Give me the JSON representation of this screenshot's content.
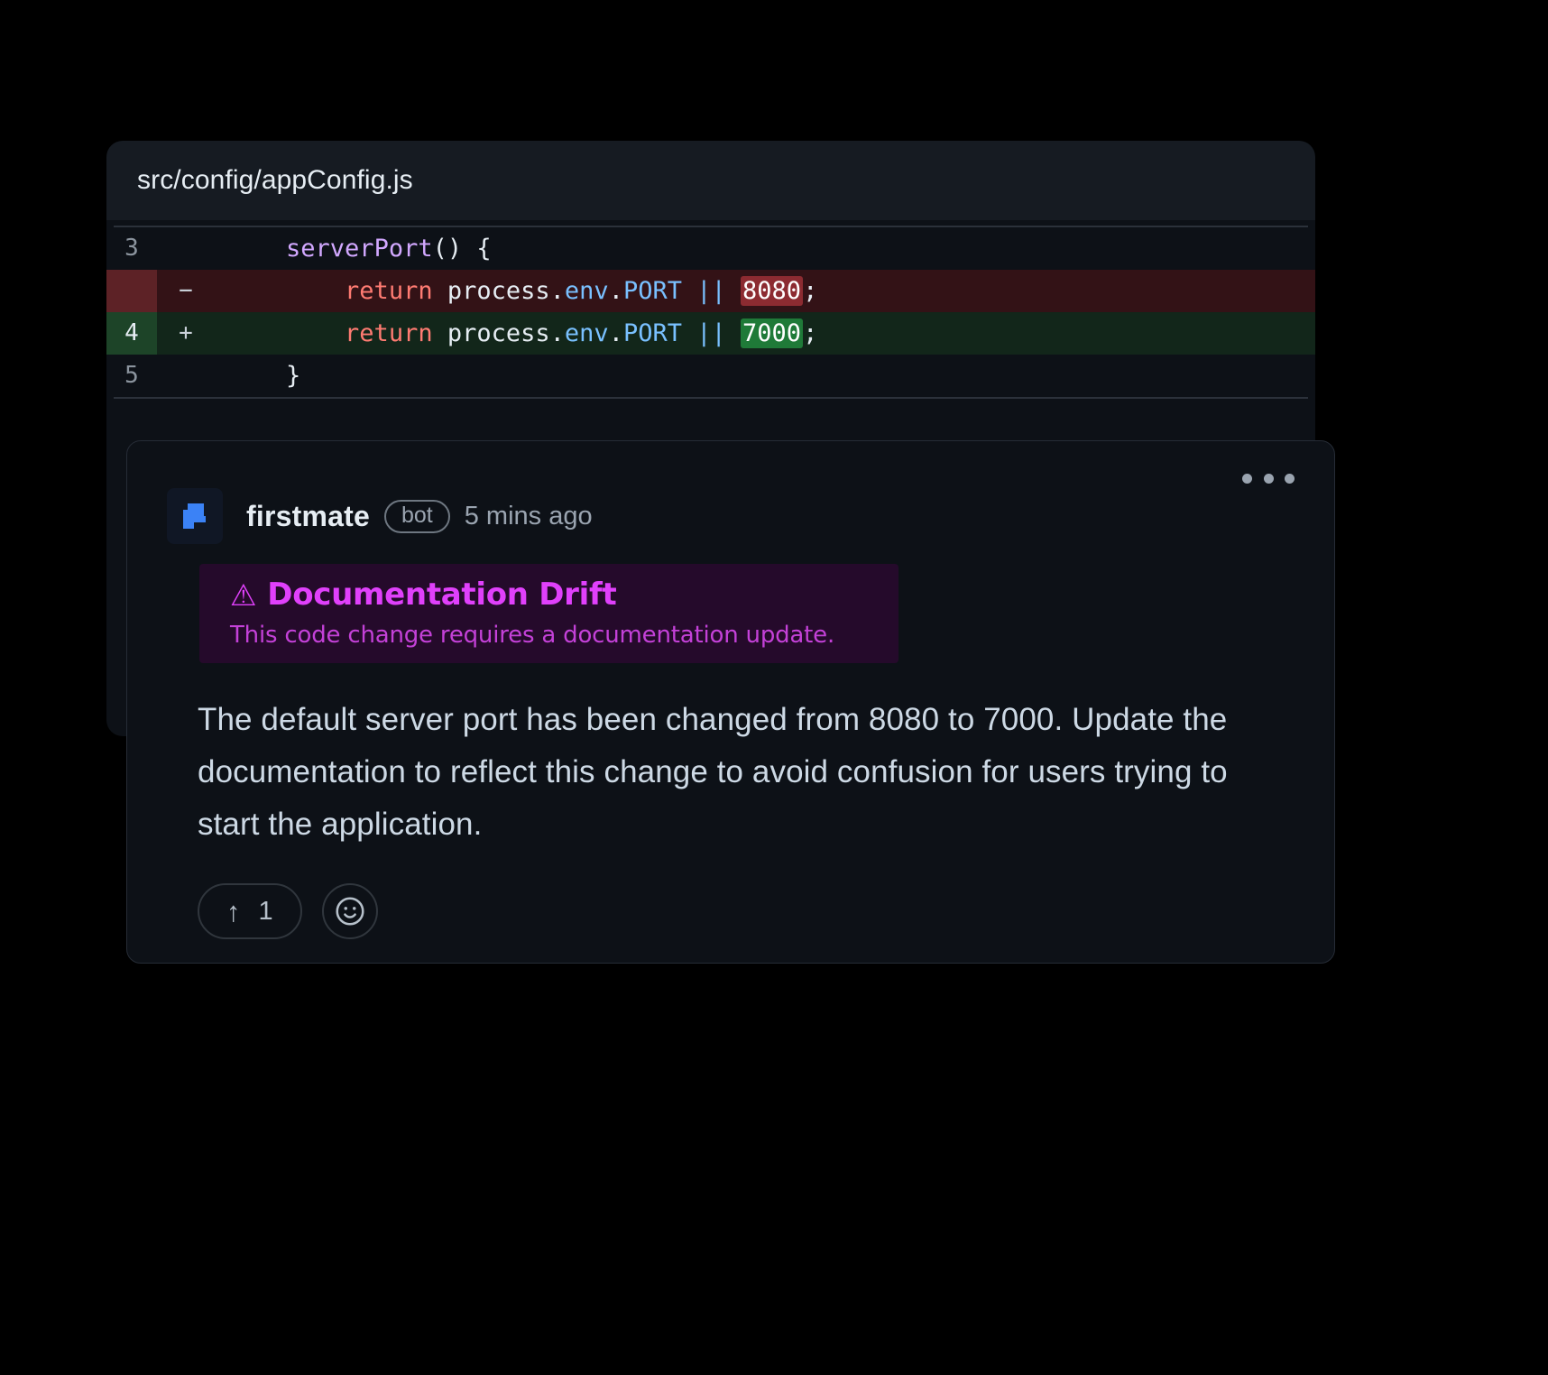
{
  "colors": {
    "page_background": "#000000",
    "card_background": "#0d1117",
    "header_background": "#161b22",
    "deletion_line": "#331216",
    "deletion_gutter": "#5d2226",
    "deletion_highlight": "#8c2b31",
    "addition_line": "#12261a",
    "addition_gutter": "#1d4428",
    "addition_highlight": "#1f7a38",
    "accent_purple": "#e040fb",
    "badge_background": "#250a2b",
    "avatar_blue": "#3b82f6"
  },
  "diff": {
    "filename": "src/config/appConfig.js",
    "lines": [
      {
        "number": "3",
        "marker": "",
        "type": "context",
        "tokens": [
          {
            "text": "    ",
            "kind": "plain"
          },
          {
            "text": "serverPort",
            "kind": "fn"
          },
          {
            "text": "() {",
            "kind": "punc"
          }
        ]
      },
      {
        "number": "",
        "marker": "−",
        "type": "deletion",
        "tokens": [
          {
            "text": "        ",
            "kind": "plain"
          },
          {
            "text": "return",
            "kind": "kw"
          },
          {
            "text": " process.",
            "kind": "plain"
          },
          {
            "text": "env",
            "kind": "prop"
          },
          {
            "text": ".",
            "kind": "plain"
          },
          {
            "text": "PORT",
            "kind": "prop"
          },
          {
            "text": " ",
            "kind": "plain"
          },
          {
            "text": "||",
            "kind": "op"
          },
          {
            "text": " ",
            "kind": "plain"
          },
          {
            "text": "8080",
            "kind": "hl-del"
          },
          {
            "text": ";",
            "kind": "punc"
          }
        ]
      },
      {
        "number": "4",
        "marker": "+",
        "type": "addition",
        "tokens": [
          {
            "text": "        ",
            "kind": "plain"
          },
          {
            "text": "return",
            "kind": "kw"
          },
          {
            "text": " process.",
            "kind": "plain"
          },
          {
            "text": "env",
            "kind": "prop"
          },
          {
            "text": ".",
            "kind": "plain"
          },
          {
            "text": "PORT",
            "kind": "prop"
          },
          {
            "text": " ",
            "kind": "plain"
          },
          {
            "text": "||",
            "kind": "op"
          },
          {
            "text": " ",
            "kind": "plain"
          },
          {
            "text": "7000",
            "kind": "hl-add"
          },
          {
            "text": ";",
            "kind": "punc"
          }
        ]
      },
      {
        "number": "5",
        "marker": "",
        "type": "context",
        "tokens": [
          {
            "text": "    }",
            "kind": "punc"
          }
        ]
      }
    ]
  },
  "comment": {
    "author": "firstmate",
    "bot_label": "bot",
    "timestamp": "5 mins ago",
    "avatar_icon": "firstmate-logo-icon",
    "menu_icon": "more-options-icon",
    "badge": {
      "warning_icon": "⚠",
      "title": "Documentation Drift",
      "subtitle": "This code change requires a documentation  update."
    },
    "body": "The default server port has been changed from 8080 to 7000. Update the documentation to reflect this change to avoid confusion for users trying to start the application.",
    "reactions": {
      "upvote_icon": "↑",
      "upvote_count": "1",
      "add_reaction_icon": "☺"
    }
  }
}
